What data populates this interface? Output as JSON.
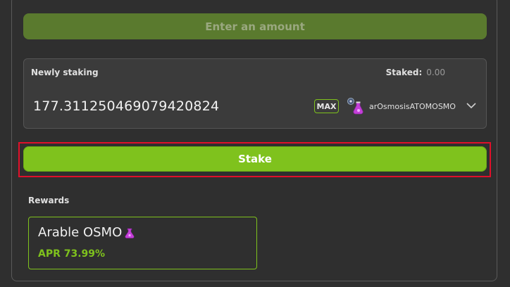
{
  "buttons": {
    "enter_amount_label": "Enter an amount",
    "stake_label": "Stake",
    "max_label": "MAX"
  },
  "staking": {
    "newly_staking_label": "Newly staking",
    "staked_label": "Staked:",
    "staked_value": "0.00",
    "amount": "177.311250469079420824",
    "token_name": "arOsmosisATOMOSMO",
    "token_icon": "flask-icon"
  },
  "rewards": {
    "label": "Rewards",
    "card": {
      "name": "Arable OSMO",
      "apr": "APR 73.99%",
      "icon": "flask-icon"
    }
  },
  "colors": {
    "accent": "#7fc21d",
    "disabled_button": "#5a7a2e",
    "highlight": "#e0102a",
    "background": "#2f2f2f"
  }
}
